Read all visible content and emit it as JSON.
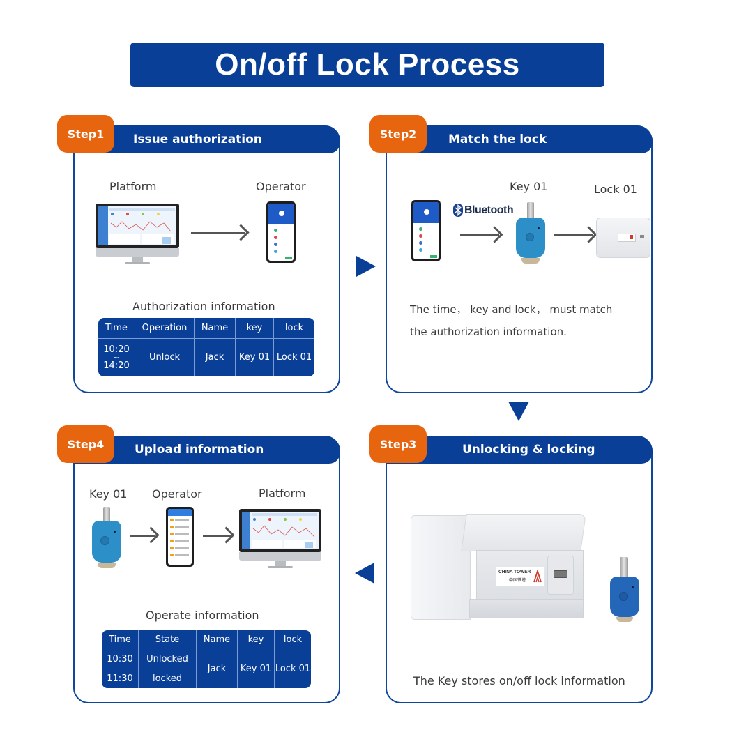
{
  "title": "On/off Lock Process",
  "colors": {
    "primary_blue": "#0a3f97",
    "step_orange": "#e8650f",
    "text_gray": "#3a3a3a"
  },
  "steps": [
    {
      "badge": "Step1",
      "title": "Issue authorization",
      "labels": {
        "source": "Platform",
        "target": "Operator"
      },
      "table_caption": "Authorization information",
      "table": {
        "headers": [
          "Time",
          "Operation",
          "Name",
          "key",
          "lock"
        ],
        "rows": [
          {
            "time_start": "10:20",
            "time_sep": "~",
            "time_end": "14:20",
            "operation": "Unlock",
            "name": "Jack",
            "key": "Key 01",
            "lock": "Lock 01"
          }
        ]
      }
    },
    {
      "badge": "Step2",
      "title": "Match the lock",
      "labels": {
        "bluetooth": "Bluetooth",
        "key": "Key 01",
        "lock": "Lock 01"
      },
      "description_line1": "The time， key and lock， must match",
      "description_line2": "the authorization information."
    },
    {
      "badge": "Step3",
      "title": "Unlocking &  locking",
      "lock_brand": "CHINA TOWER",
      "lock_brand_cn": "中国铁塔",
      "caption": "The Key stores on/off lock information"
    },
    {
      "badge": "Step4",
      "title": "Upload information",
      "labels": {
        "key": "Key 01",
        "operator": "Operator",
        "platform": "Platform"
      },
      "table_caption": "Operate information",
      "table": {
        "headers": [
          "Time",
          "State",
          "Name",
          "key",
          "lock"
        ],
        "rows": [
          {
            "time": "10:30",
            "state": "Unlocked"
          },
          {
            "time": "11:30",
            "state": "locked"
          }
        ],
        "shared": {
          "name": "Jack",
          "key": "Key 01",
          "lock": "Lock 01"
        }
      }
    }
  ],
  "flow_arrows": [
    {
      "from": "Step1",
      "to": "Step2",
      "direction": "right"
    },
    {
      "from": "Step2",
      "to": "Step3",
      "direction": "down"
    },
    {
      "from": "Step3",
      "to": "Step4",
      "direction": "left"
    }
  ]
}
